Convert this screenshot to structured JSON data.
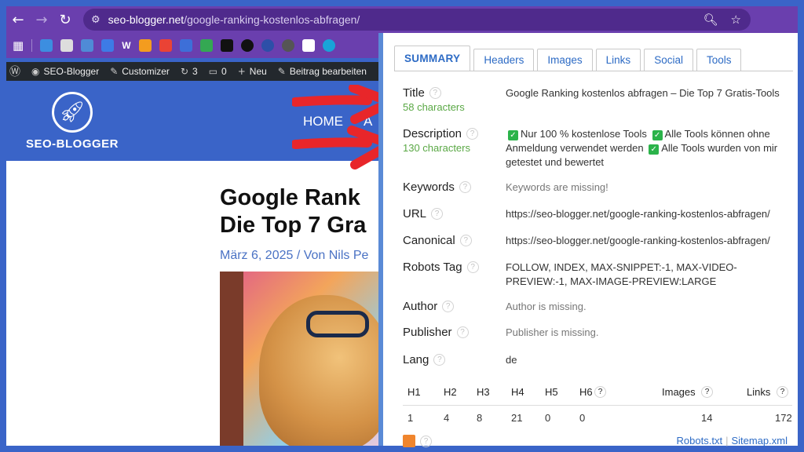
{
  "browser": {
    "back_icon": "arrow-left-icon",
    "forward_icon": "arrow-right-icon",
    "reload_icon": "reload-icon",
    "url_host": "seo-blogger.net",
    "url_path": "/google-ranking-kostenlos-abfragen/"
  },
  "bookmarks": {
    "word_label": "W"
  },
  "wpbar": {
    "site": "SEO-Blogger",
    "customizer": "Customizer",
    "updates": "3",
    "comments": "0",
    "new": "Neu",
    "edit": "Beitrag bearbeiten"
  },
  "site": {
    "logo_text": "SEO-BLOGGER",
    "menu": [
      "HOME",
      "A"
    ]
  },
  "post": {
    "title_line1": "Google Rank",
    "title_line2": "Die Top 7 Gra",
    "meta": "März 6, 2025 / Von Nils Pe"
  },
  "panel": {
    "tabs": [
      "SUMMARY",
      "Headers",
      "Images",
      "Links",
      "Social",
      "Tools"
    ],
    "title": {
      "label": "Title",
      "sub": "58 characters",
      "value": "Google Ranking kostenlos abfragen – Die Top 7 Gratis-Tools"
    },
    "description": {
      "label": "Description",
      "sub": "130 characters",
      "part1": "Nur 100 % kostenlose Tools",
      "part2": "Alle Tools können ohne Anmeldung verwendet werden",
      "part3": "Alle Tools wurden von mir getestet und bewertet"
    },
    "keywords": {
      "label": "Keywords",
      "value": "Keywords are missing!"
    },
    "url": {
      "label": "URL",
      "value": "https://seo-blogger.net/google-ranking-kostenlos-abfragen/"
    },
    "canonical": {
      "label": "Canonical",
      "value": "https://seo-blogger.net/google-ranking-kostenlos-abfragen/"
    },
    "robots": {
      "label": "Robots Tag",
      "value": "FOLLOW, INDEX, MAX-SNIPPET:-1, MAX-VIDEO-PREVIEW:-1, MAX-IMAGE-PREVIEW:LARGE"
    },
    "author": {
      "label": "Author",
      "value": "Author is missing."
    },
    "publisher": {
      "label": "Publisher",
      "value": "Publisher is missing."
    },
    "lang": {
      "label": "Lang",
      "value": "de"
    },
    "headings": {
      "cols": [
        "H1",
        "H2",
        "H3",
        "H4",
        "H5",
        "H6",
        "Images",
        "Links"
      ],
      "values": [
        "1",
        "4",
        "8",
        "21",
        "0",
        "0",
        "14",
        "172"
      ]
    },
    "footer": {
      "robots": "Robots.txt",
      "sitemap": "Sitemap.xml"
    }
  },
  "colors": {
    "accent": "#2d6bc5",
    "chars_green": "#5aa845",
    "browser_purple": "#6a3fae",
    "wp_blue": "#3a64c8",
    "arrow_red": "#e8262a"
  }
}
